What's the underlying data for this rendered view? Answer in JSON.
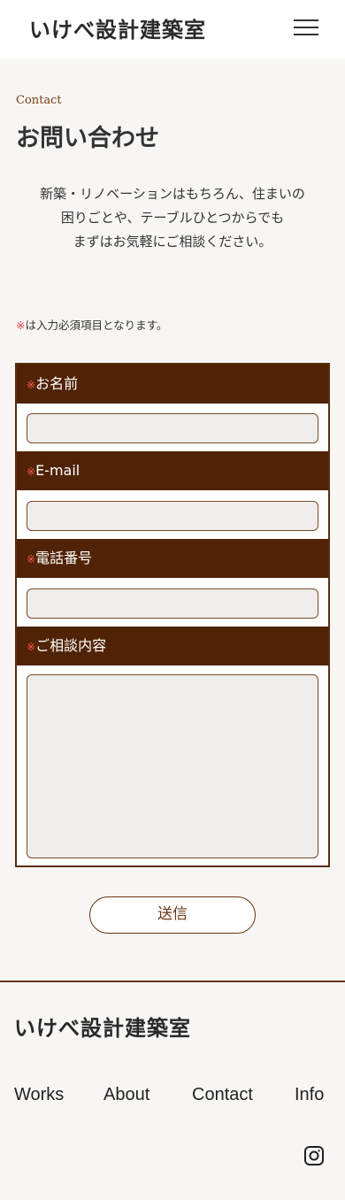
{
  "header": {
    "logo": "いけべ設計建築室"
  },
  "hero": {
    "eyebrow": "Contact",
    "title": "お問い合わせ",
    "intro_lines": [
      "新築・リノベーションはもちろん、住まいの",
      "困りごとや、テーブルひとつからでも",
      "まずはお気軽にご相談ください。"
    ]
  },
  "form": {
    "required_mark": "※",
    "required_note": "は入力必須項目となります。",
    "fields": [
      {
        "label": "お名前",
        "value": ""
      },
      {
        "label": "E-mail",
        "value": ""
      },
      {
        "label": "電話番号",
        "value": ""
      },
      {
        "label": "ご相談内容",
        "value": ""
      }
    ],
    "submit_label": "送信"
  },
  "footer": {
    "logo": "いけべ設計建築室",
    "nav": [
      "Works",
      "About",
      "Contact",
      "Info"
    ]
  },
  "colors": {
    "brand_brown": "#502306",
    "accent_brown": "#7a3b10",
    "required_red": "#d44444"
  },
  "icons": [
    "menu-icon",
    "instagram-icon"
  ]
}
